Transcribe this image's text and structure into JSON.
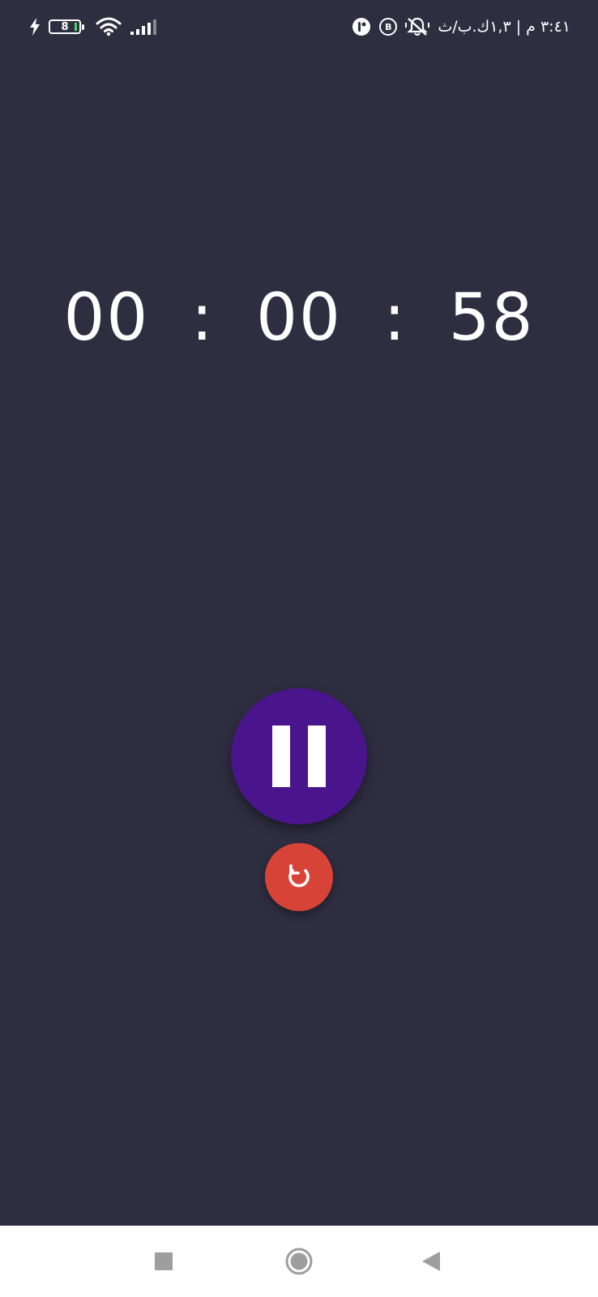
{
  "status_bar": {
    "battery_level": "8",
    "time_text": "٣:٤١ م | ١,٣ك.ب/ث",
    "whatsapp_business_badge": "B",
    "icons": [
      "charging-icon",
      "battery-icon",
      "wifi-icon",
      "signal-icon",
      "app-notification-icon",
      "whatsapp-business-icon",
      "notifications-muted-icon"
    ]
  },
  "timer": {
    "hours": "00",
    "minutes": "00",
    "seconds": "58",
    "separator": ":"
  },
  "controls": {
    "pause_icon": "pause-icon",
    "reset_icon": "reset-icon"
  },
  "nav_bar": {
    "icons": [
      "recents-icon",
      "home-icon",
      "back-icon"
    ]
  },
  "colors": {
    "background": "#2e2e41",
    "pause_button": "#4a148c",
    "reset_button": "#d84338",
    "nav_bar": "#ffffff",
    "nav_icons": "#9e9e9e"
  }
}
